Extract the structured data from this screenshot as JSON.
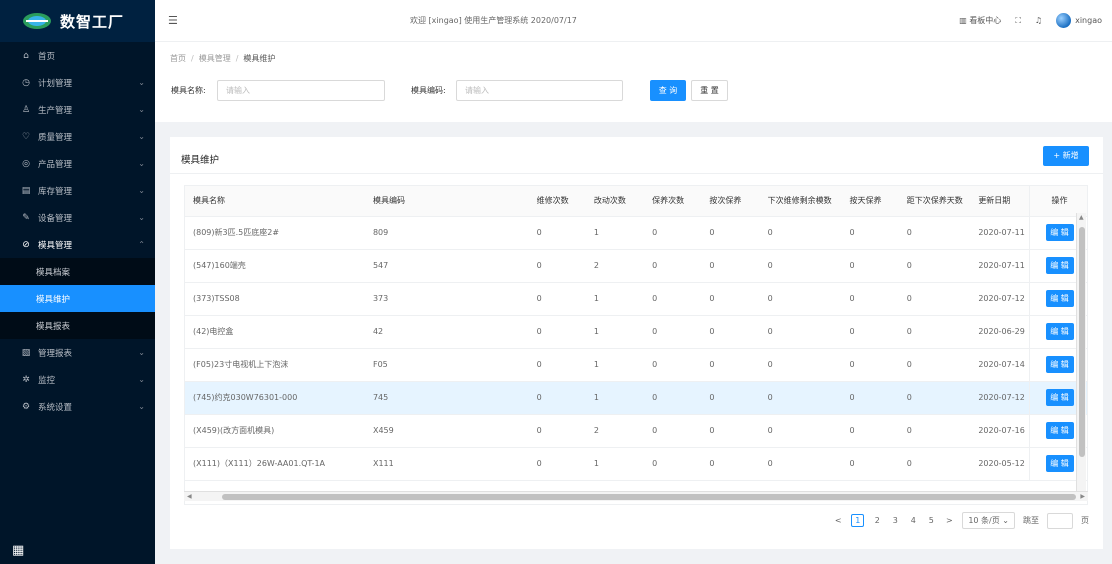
{
  "app": {
    "name": "数智工厂"
  },
  "colors": {
    "primary": "#1890ff",
    "sidebar_bg": "#001529",
    "highlight_row": "#e6f4ff"
  },
  "sidebar": {
    "items": [
      {
        "label": "首页",
        "icon": "home-icon",
        "glyph": "⌂"
      },
      {
        "label": "计划管理",
        "icon": "clock-icon",
        "glyph": "◷"
      },
      {
        "label": "生产管理",
        "icon": "person-icon",
        "glyph": "♙"
      },
      {
        "label": "质量管理",
        "icon": "shield-icon",
        "glyph": "♡"
      },
      {
        "label": "产品管理",
        "icon": "product-icon",
        "glyph": "◎"
      },
      {
        "label": "库存管理",
        "icon": "inventory-icon",
        "glyph": "▤"
      },
      {
        "label": "设备管理",
        "icon": "wrench-icon",
        "glyph": "✎"
      },
      {
        "label": "模具管理",
        "icon": "mold-icon",
        "glyph": "⊘"
      },
      {
        "label": "管理报表",
        "icon": "report-icon",
        "glyph": "▧"
      },
      {
        "label": "监控",
        "icon": "monitor-icon",
        "glyph": "✲"
      },
      {
        "label": "系统设置",
        "icon": "settings-icon",
        "glyph": "⚙"
      }
    ],
    "sub_items": [
      {
        "label": "模具档案"
      },
      {
        "label": "模具维护"
      },
      {
        "label": "模具报表"
      }
    ]
  },
  "header": {
    "welcome": "欢迎 [xingao] 使用生产管理系统 2020/07/17",
    "dashboard": "看板中心",
    "username": "xingao"
  },
  "breadcrumb": {
    "home": "首页",
    "parent": "模具管理",
    "current": "模具维护"
  },
  "filters": {
    "name_label": "模具名称:",
    "name_placeholder": "请输入",
    "code_label": "模具编码:",
    "code_placeholder": "请输入",
    "search": "查 询",
    "reset": "重 置"
  },
  "card": {
    "title": "模具维护",
    "add_button": "+ 新增"
  },
  "table": {
    "headers": [
      "模具名称",
      "模具编码",
      "维修次数",
      "改动次数",
      "保养次数",
      "按次保养",
      "下次维修剩余模数",
      "按天保养",
      "距下次保养天数",
      "更新日期",
      "操作"
    ],
    "rows": [
      [
        "(809)新3匹.5匹底座2#",
        "809",
        "0",
        "1",
        "0",
        "0",
        "0",
        "0",
        "0",
        "2020-07-11",
        "编 辑"
      ],
      [
        "(547)160端壳",
        "547",
        "0",
        "2",
        "0",
        "0",
        "0",
        "0",
        "0",
        "2020-07-11",
        "编 辑"
      ],
      [
        "(373)TSS08",
        "373",
        "0",
        "1",
        "0",
        "0",
        "0",
        "0",
        "0",
        "2020-07-12",
        "编 辑"
      ],
      [
        "(42)电控盒",
        "42",
        "0",
        "1",
        "0",
        "0",
        "0",
        "0",
        "0",
        "2020-06-29",
        "编 辑"
      ],
      [
        "(F05)23寸电视机上下泡沫",
        "F05",
        "0",
        "1",
        "0",
        "0",
        "0",
        "0",
        "0",
        "2020-07-14",
        "编 辑"
      ],
      [
        "(745)约克030W76301-000",
        "745",
        "0",
        "1",
        "0",
        "0",
        "0",
        "0",
        "0",
        "2020-07-12",
        "编 辑"
      ],
      [
        "(X459)(改方面机模具)",
        "X459",
        "0",
        "2",
        "0",
        "0",
        "0",
        "0",
        "0",
        "2020-07-16",
        "编 辑"
      ],
      [
        "(X111)（X111）26W-AA01.QT-1A",
        "X111",
        "0",
        "1",
        "0",
        "0",
        "0",
        "0",
        "0",
        "2020-05-12",
        "编 辑"
      ]
    ]
  },
  "pagination": {
    "prev": "<",
    "pages": [
      "1",
      "2",
      "3",
      "4",
      "5"
    ],
    "next": ">",
    "page_size": "10 条/页",
    "jump_label": "跳至",
    "page_suffix": "页"
  }
}
